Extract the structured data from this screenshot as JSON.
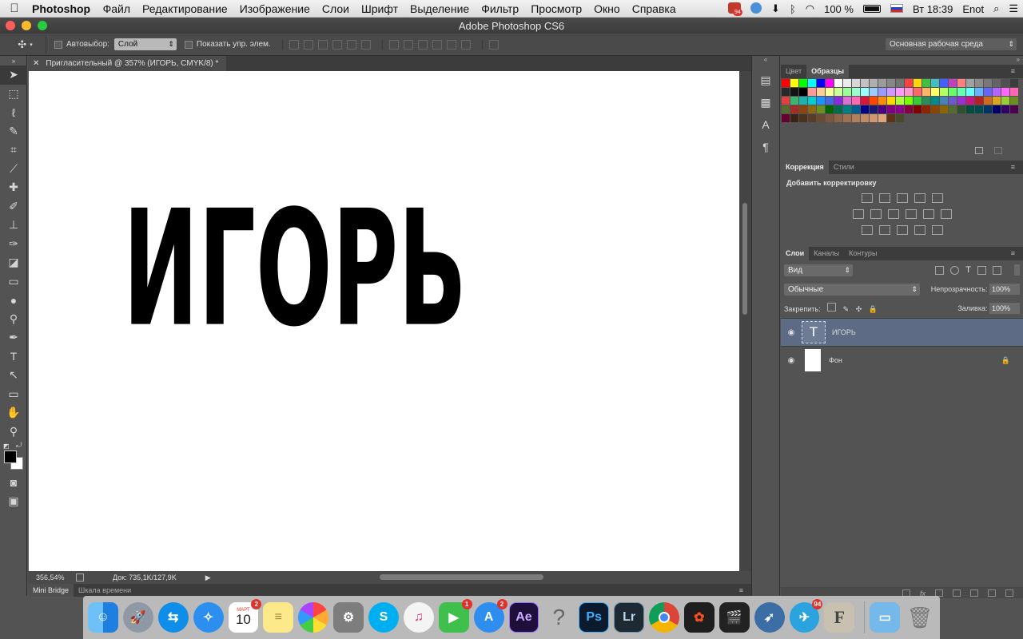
{
  "menubar": {
    "app_name": "Photoshop",
    "items": [
      "Файл",
      "Редактирование",
      "Изображение",
      "Слои",
      "Шрифт",
      "Выделение",
      "Фильтр",
      "Просмотр",
      "Окно",
      "Справка"
    ],
    "tray_badge": "94",
    "battery": "100 %",
    "clock": "Вт 18:39",
    "user": "Enot"
  },
  "window": {
    "title": "Adobe Photoshop CS6"
  },
  "options": {
    "autoselect_label": "Автовыбор:",
    "autoselect_value": "Слой",
    "show_transform_label": "Показать упр. элем.",
    "workspace": "Основная рабочая среда"
  },
  "document": {
    "tab_title": "Пригласительный  @ 357% (ИГОРЬ, CMYK/8) *",
    "canvas_text": "ИГОРЬ",
    "zoom": "356,54%",
    "doc_info": "Док: 735,1K/127,9K"
  },
  "bottom_tabs": {
    "mini_bridge": "Mini Bridge",
    "timeline": "Шкала времени"
  },
  "swatch_panel": {
    "tab_color": "Цвет",
    "tab_swatches": "Образцы",
    "swatches": [
      "#ff0000",
      "#ffff00",
      "#00ff00",
      "#00ffff",
      "#0000ff",
      "#ff00ff",
      "#ffffff",
      "#ebebeb",
      "#d7d7d7",
      "#c3c3c3",
      "#afafaf",
      "#9b9b9b",
      "#878787",
      "#737373",
      "#ff4040",
      "#ffd700",
      "#40c040",
      "#40c0c0",
      "#4060ff",
      "#c040c0",
      "#ff8080",
      "#a0a0a0",
      "#8c8c8c",
      "#787878",
      "#646464",
      "#505050",
      "#3c3c3c",
      "#282828",
      "#141414",
      "#000000",
      "#ff9999",
      "#ffcc99",
      "#ffff99",
      "#ccff99",
      "#99ff99",
      "#99ffcc",
      "#99ffff",
      "#99ccff",
      "#9999ff",
      "#cc99ff",
      "#ff99ff",
      "#ff99cc",
      "#ff6666",
      "#ffb366",
      "#ffff66",
      "#b3ff66",
      "#66ff66",
      "#66ffb3",
      "#66ffff",
      "#66b3ff",
      "#6666ff",
      "#b366ff",
      "#ff66ff",
      "#ff66b3",
      "#e04040",
      "#3cb371",
      "#20b2aa",
      "#00ced1",
      "#1e90ff",
      "#4169e1",
      "#8a2be2",
      "#da70d6",
      "#ff69b4",
      "#dc143c",
      "#ff4500",
      "#ff8c00",
      "#ffd700",
      "#adff2f",
      "#7cfc00",
      "#32cd32",
      "#2e8b57",
      "#008b8b",
      "#4682b4",
      "#6a5acd",
      "#9932cc",
      "#c71585",
      "#b22222",
      "#d2691e",
      "#daa520",
      "#9acd32",
      "#6b8e23",
      "#556b2f",
      "#a52a2a",
      "#8b4513",
      "#8b6914",
      "#6b8e23",
      "#006400",
      "#006a4e",
      "#008080",
      "#005f8f",
      "#00008b",
      "#191970",
      "#4b0082",
      "#800080",
      "#8b008b",
      "#800040",
      "#800000",
      "#8b2500",
      "#8b4500",
      "#8b6508",
      "#556b2f",
      "#2f4f2f",
      "#004d40",
      "#00494d",
      "#003366",
      "#000066",
      "#330066",
      "#4d004d",
      "#660033",
      "#3b2416",
      "#4a3120",
      "#5a3d29",
      "#6b4a33",
      "#7c573d",
      "#8d6447",
      "#9e7151",
      "#af7e5b",
      "#c08b65",
      "#d1986f",
      "#e2a579",
      "#5c3317",
      "#4a4a2a"
    ]
  },
  "adjustments_panel": {
    "tab_correction": "Коррекция",
    "tab_styles": "Стили",
    "title": "Добавить корректировку"
  },
  "layers_panel": {
    "tab_layers": "Слои",
    "tab_channels": "Каналы",
    "tab_paths": "Контуры",
    "filter_value": "Вид",
    "blend_mode": "Обычные",
    "opacity_label": "Непрозрачность:",
    "opacity_value": "100%",
    "lock_label": "Закрепить:",
    "fill_label": "Заливка:",
    "fill_value": "100%",
    "layers": [
      {
        "name": "ИГОРЬ",
        "kind": "text",
        "selected": true
      },
      {
        "name": "Фон",
        "kind": "background",
        "locked": true
      }
    ]
  },
  "dock": {
    "calendar_month": "МАРТ",
    "calendar_day": "10",
    "calendar_badge": "2",
    "facetime_badge": "1",
    "appstore_badge": "2",
    "telegram_badge": "94",
    "ae_label": "Ae",
    "ps_label": "Ps",
    "lr_label": "Lr"
  },
  "colors": {
    "ps_bg": "#535353",
    "panel_dark": "#3c3c3c",
    "selected_layer": "#5d6b85"
  }
}
